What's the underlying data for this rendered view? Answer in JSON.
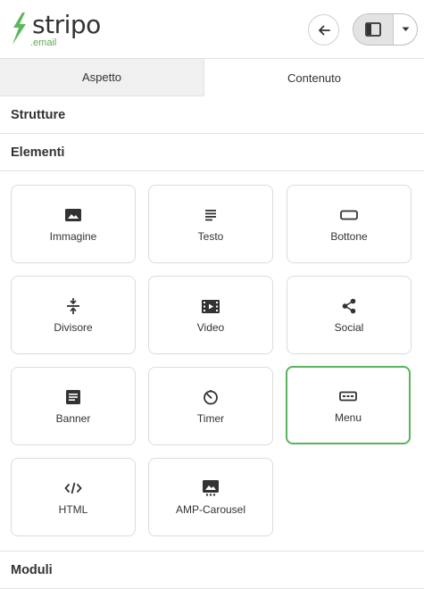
{
  "header": {
    "logo_word": "stripo",
    "logo_sub": ".email",
    "logo_color": "#5cb85c"
  },
  "tabs": [
    {
      "label": "Aspetto",
      "active": false
    },
    {
      "label": "Contenuto",
      "active": true
    }
  ],
  "sections": {
    "strutture": "Strutture",
    "elementi": "Elementi",
    "moduli": "Moduli"
  },
  "elements": [
    {
      "label": "Immagine",
      "icon": "image-icon"
    },
    {
      "label": "Testo",
      "icon": "text-icon"
    },
    {
      "label": "Bottone",
      "icon": "button-icon"
    },
    {
      "label": "Divisore",
      "icon": "divider-icon"
    },
    {
      "label": "Video",
      "icon": "video-icon"
    },
    {
      "label": "Social",
      "icon": "share-icon"
    },
    {
      "label": "Banner",
      "icon": "banner-icon"
    },
    {
      "label": "Timer",
      "icon": "timer-icon"
    },
    {
      "label": "Menu",
      "icon": "menu-icon",
      "selected": true
    },
    {
      "label": "HTML",
      "icon": "code-icon"
    },
    {
      "label": "AMP-Carousel",
      "icon": "carousel-icon"
    }
  ],
  "colors": {
    "accent_green": "#58b35a",
    "border": "#dcdcdc",
    "tab_inactive_bg": "#f0f0f0"
  }
}
